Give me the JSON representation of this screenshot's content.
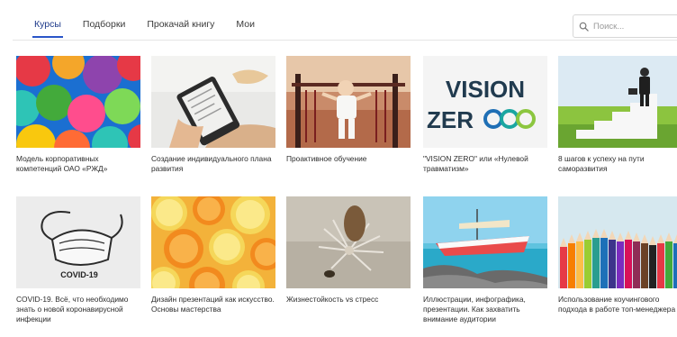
{
  "nav": {
    "tabs": [
      {
        "label": "Курсы",
        "active": true
      },
      {
        "label": "Подборки",
        "active": false
      },
      {
        "label": "Прокачай книгу",
        "active": false
      },
      {
        "label": "Мои",
        "active": false
      }
    ]
  },
  "search": {
    "placeholder": "Поиск..."
  },
  "colors": {
    "accent": "#2a55c8",
    "tab_active_text": "#1e3a8a"
  },
  "cards": [
    {
      "title": "Модель корпоративных компетенций ОАО «РЖД»",
      "image": "colorful-umbrellas"
    },
    {
      "title": "Создание индивидуального плана развития",
      "image": "ebook-reader"
    },
    {
      "title": "Проактивное обучение",
      "image": "child-on-playground"
    },
    {
      "title": "\"VISION ZERO\" или «Нулевой травматизм»",
      "image": "vision-zero-logo",
      "logo_line1": "VISION",
      "logo_line2": "ZER"
    },
    {
      "title": "8 шагов к успеху на пути саморазвития",
      "image": "businessman-on-stairs"
    },
    {
      "title": "COVID-19. Всё, что необходимо знать о новой коронавирусной инфекции",
      "image": "mask-drawing",
      "image_caption": "COVID-19"
    },
    {
      "title": "Дизайн презентаций как искусство. Основы мастерства",
      "image": "citrus-slices"
    },
    {
      "title": "Жизнестойкость vs стресс",
      "image": "dry-flower"
    },
    {
      "title": "Иллюстрации, инфографика, презентации. Как захватить внимание аудитории",
      "image": "boat-on-sea"
    },
    {
      "title": "Использование коучингового подхода в работе топ-менеджера",
      "image": "colored-pencils"
    }
  ]
}
